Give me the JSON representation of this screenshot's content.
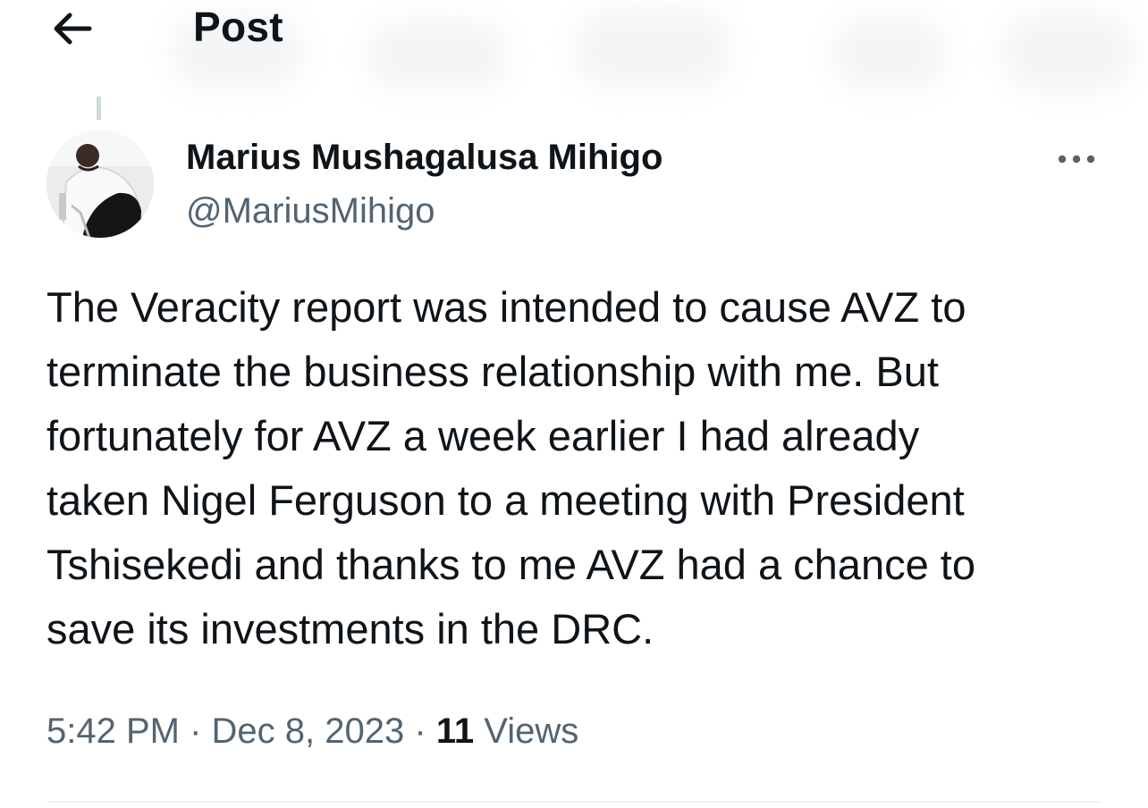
{
  "header": {
    "title": "Post",
    "back_icon": "arrow-left-icon"
  },
  "tweet": {
    "author": {
      "name": "Marius Mushagalusa Mihigo",
      "handle": "@MariusMihigo",
      "avatar": "profile-photo"
    },
    "more_icon": "more-horizontal-icon",
    "text": "The Veracity report was intended to cause AVZ to\nterminate the business relationship with me. But\nfortunately for AVZ a week earlier I had already\ntaken Nigel Ferguson to a meeting with President\nTshisekedi and thanks to me AVZ had a chance to\nsave its investments in the DRC.",
    "time": "5:42 PM",
    "separator": "·",
    "date": "Dec 8, 2023",
    "views_count": "11",
    "views_label": "Views"
  },
  "colors": {
    "text": "#0f1419",
    "secondary": "#536471",
    "divider": "#eff3f4"
  }
}
